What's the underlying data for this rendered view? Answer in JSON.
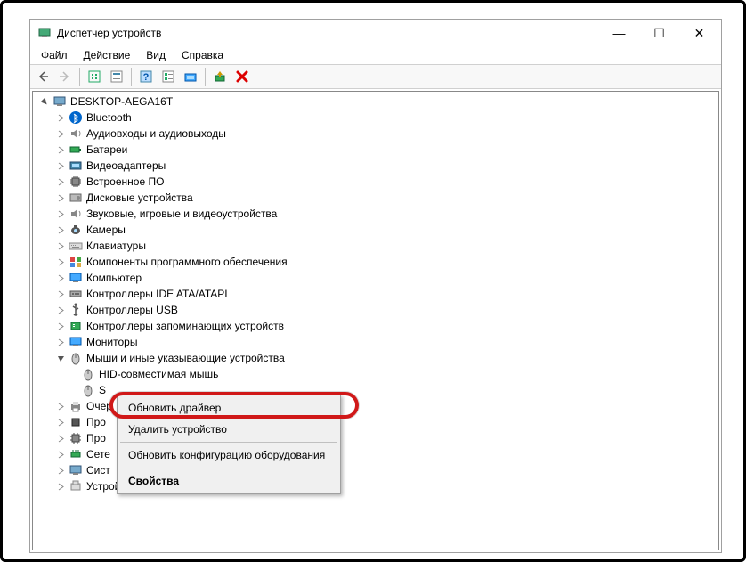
{
  "titlebar": {
    "title": "Диспетчер устройств"
  },
  "winbtns": {
    "min": "—",
    "max": "☐",
    "close": "✕"
  },
  "menu": {
    "file": "Файл",
    "action": "Действие",
    "view": "Вид",
    "help": "Справка"
  },
  "tree": {
    "root": "DESKTOP-AEGA16T",
    "cats": {
      "bluetooth": "Bluetooth",
      "audio": "Аудиовходы и аудиовыходы",
      "batteries": "Батареи",
      "video": "Видеоадаптеры",
      "firmware": "Встроенное ПО",
      "disks": "Дисковые устройства",
      "soundgames": "Звуковые, игровые и видеоустройства",
      "cameras": "Камеры",
      "keyboards": "Клавиатуры",
      "software": "Компоненты программного обеспечения",
      "computer": "Компьютер",
      "ide": "Контроллеры IDE ATA/ATAPI",
      "usb": "Контроллеры USB",
      "storage": "Контроллеры запоминающих устройств",
      "monitors": "Мониторы",
      "mice": "Мыши и иные указывающие устройства",
      "queues": "Очер",
      "proc": "Про",
      "proc2": "Про",
      "net": "Сете",
      "system": "Сист",
      "hid": "Устройства HID (Human Interface Devices)"
    },
    "mice_children": {
      "hid": "HID-совместимая мышь",
      "selected": "S"
    }
  },
  "ctx": {
    "update": "Обновить драйвер",
    "delete": "Удалить устройство",
    "scan": "Обновить конфигурацию оборудования",
    "props": "Свойства"
  }
}
